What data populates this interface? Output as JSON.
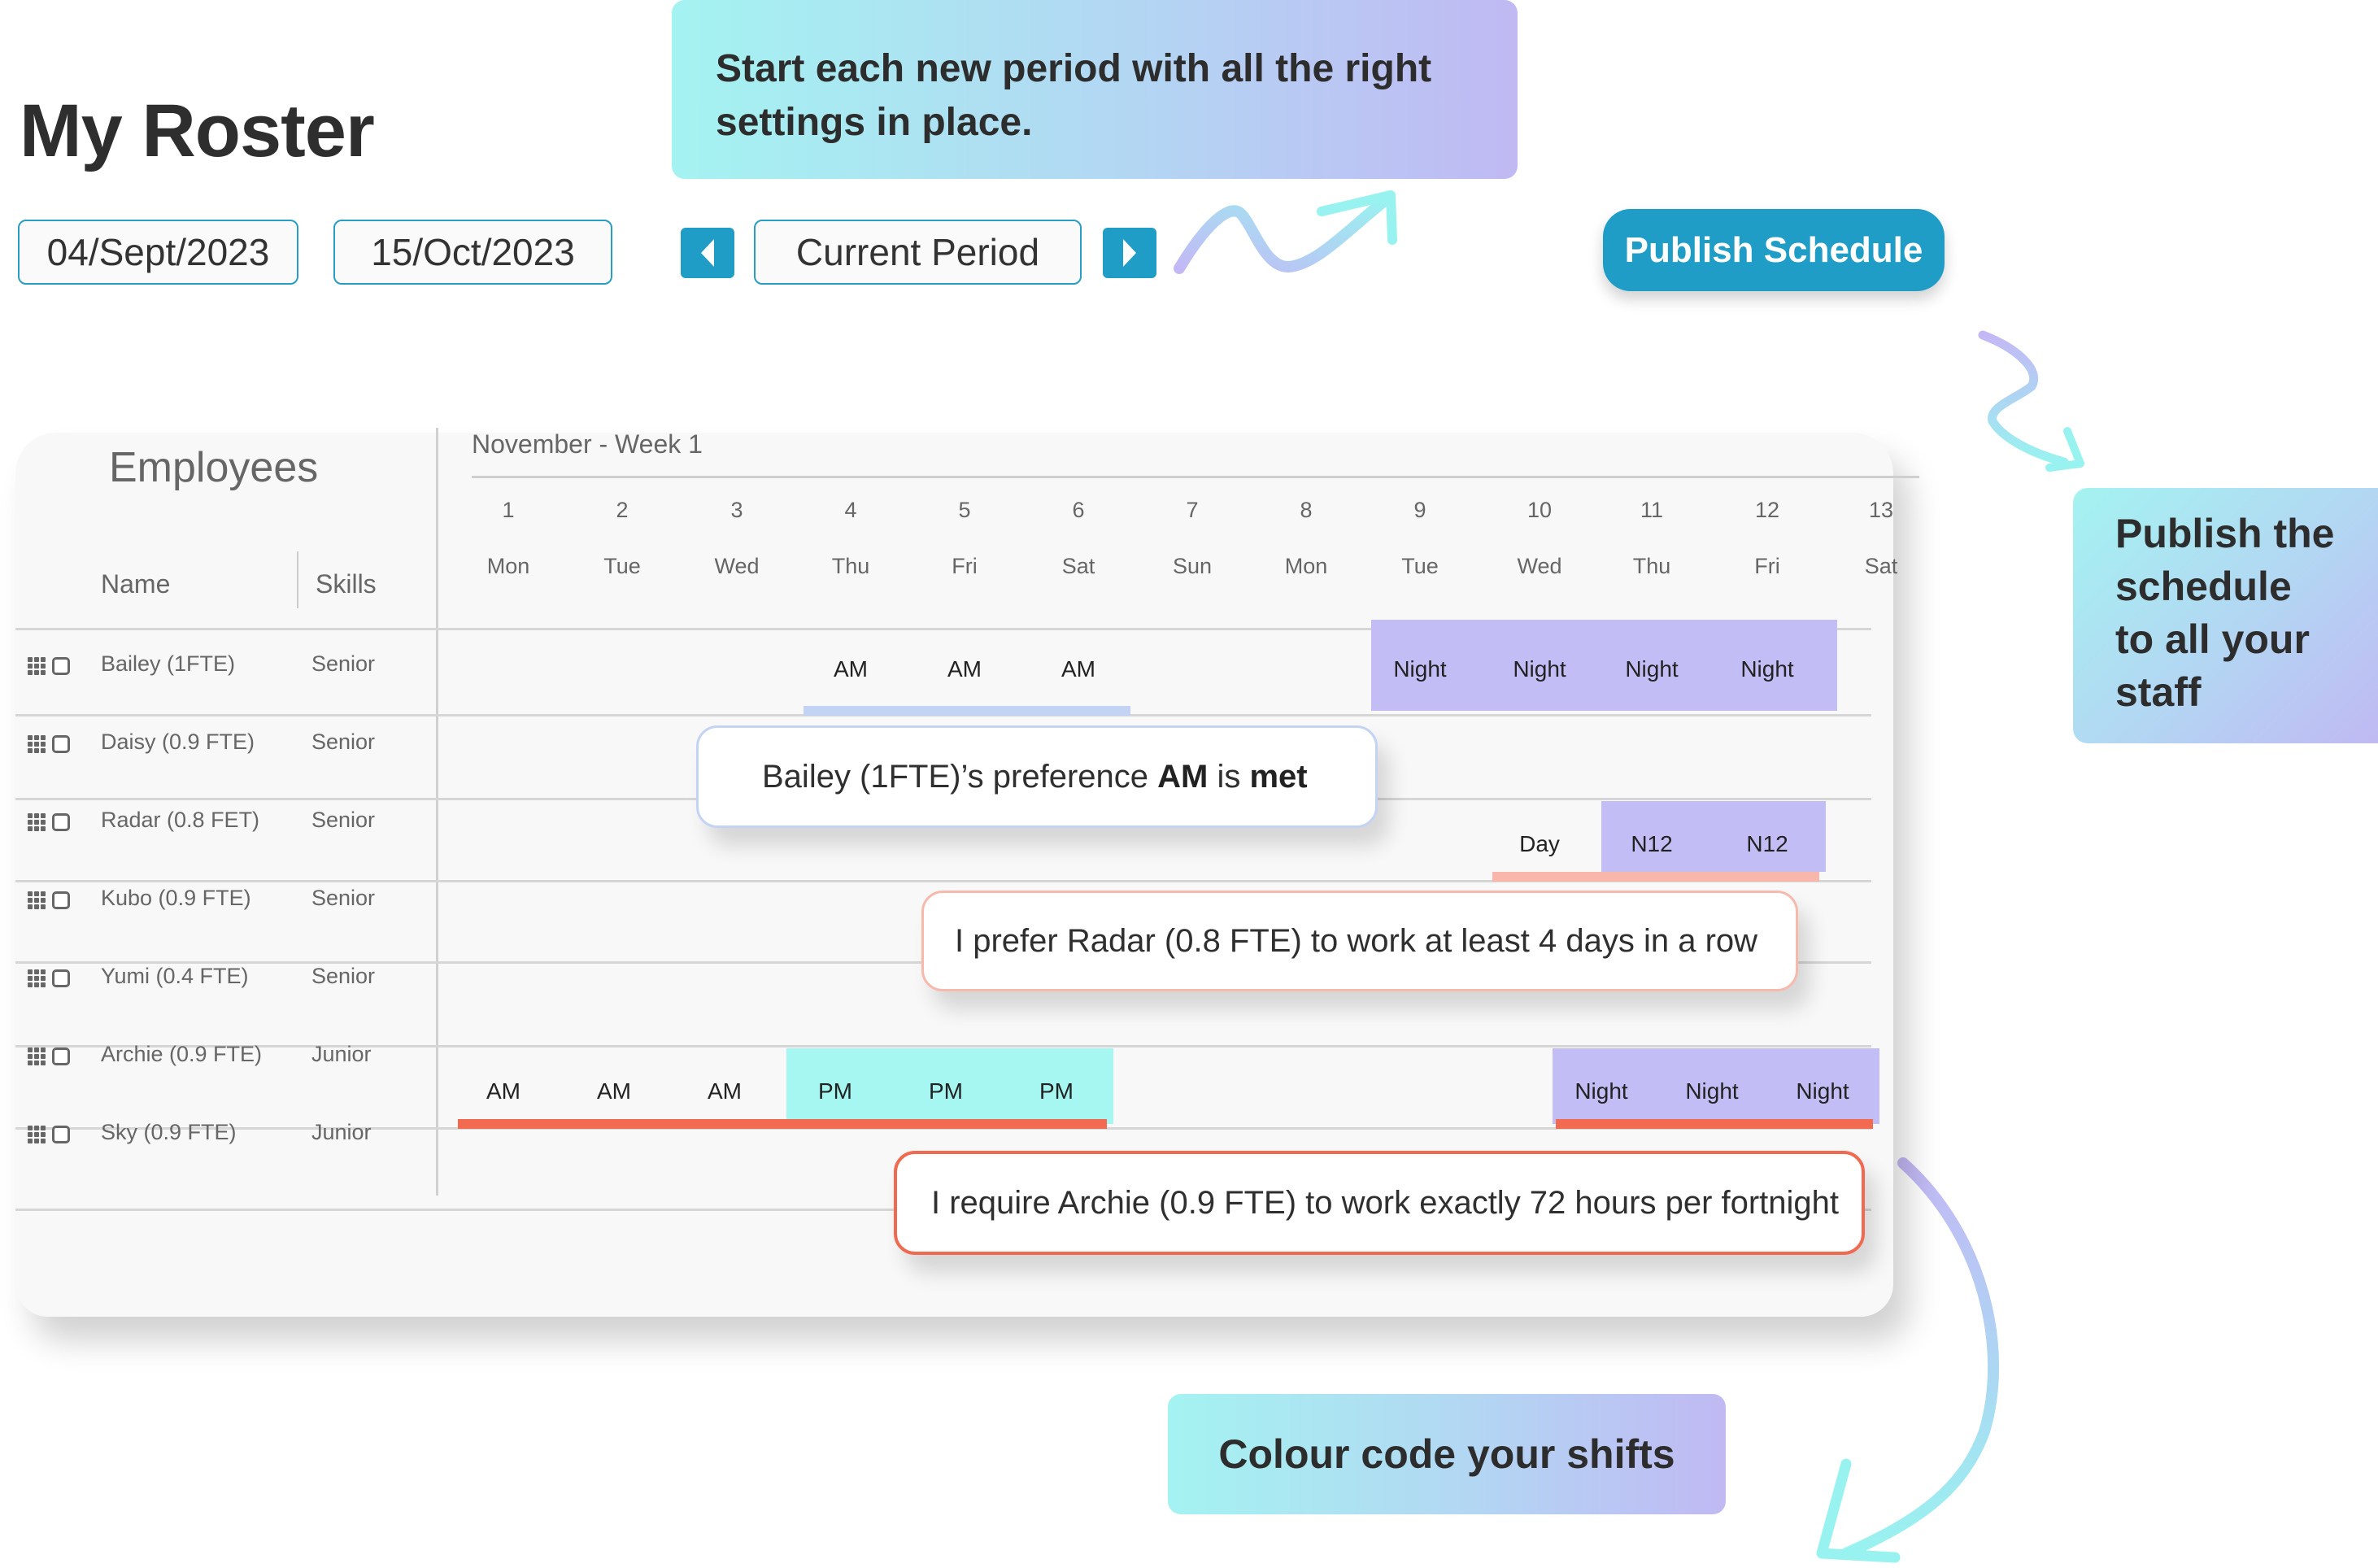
{
  "page": {
    "title": "My Roster",
    "start_date": "04/Sept/2023",
    "end_date": "15/Oct/2023",
    "period_label": "Current Period",
    "prev_icon": "caret-left-icon",
    "next_icon": "caret-right-icon",
    "publish_label": "Publish Schedule"
  },
  "callouts": {
    "period": "Start each new period with all the right settings in place.",
    "publish": "Publish the schedule to all your staff",
    "colour": "Colour code your shifts"
  },
  "colors": {
    "accent": "#1f9dc7",
    "am_underline": "#c3d3f4",
    "night": "#c2bdf5",
    "pm": "#a6f7f2",
    "soft_warning": "#f9b6aa",
    "hard_warning": "#f26a50"
  },
  "table": {
    "panel_title": "Employees",
    "name_header": "Name",
    "skills_header": "Skills",
    "week_label": "November - Week 1",
    "days": [
      {
        "num": "1",
        "name": "Mon"
      },
      {
        "num": "2",
        "name": "Tue"
      },
      {
        "num": "3",
        "name": "Wed"
      },
      {
        "num": "4",
        "name": "Thu"
      },
      {
        "num": "5",
        "name": "Fri"
      },
      {
        "num": "6",
        "name": "Sat"
      },
      {
        "num": "7",
        "name": "Sun"
      },
      {
        "num": "8",
        "name": "Mon"
      },
      {
        "num": "9",
        "name": "Tue"
      },
      {
        "num": "10",
        "name": "Wed"
      },
      {
        "num": "11",
        "name": "Thu"
      },
      {
        "num": "12",
        "name": "Fri"
      },
      {
        "num": "13",
        "name": "Sat"
      }
    ],
    "employees": [
      {
        "name": "Bailey (1FTE)",
        "skill": "Senior",
        "shifts": [
          {
            "day": 4,
            "label": "AM"
          },
          {
            "day": 5,
            "label": "AM"
          },
          {
            "day": 6,
            "label": "AM"
          },
          {
            "day": 9,
            "label": "Night",
            "fill": "night"
          },
          {
            "day": 10,
            "label": "Night",
            "fill": "night"
          },
          {
            "day": 11,
            "label": "Night",
            "fill": "night"
          },
          {
            "day": 12,
            "label": "Night",
            "fill": "night"
          }
        ],
        "underlines": [
          {
            "from": 4,
            "to": 6,
            "color": "am_underline"
          }
        ]
      },
      {
        "name": "Daisy (0.9 FTE)",
        "skill": "Senior",
        "shifts": [],
        "underlines": []
      },
      {
        "name": "Radar (0.8 FET)",
        "skill": "Senior",
        "shifts": [
          {
            "day": 10,
            "label": "Day"
          },
          {
            "day": 11,
            "label": "N12",
            "fill": "night"
          },
          {
            "day": 12,
            "label": "N12",
            "fill": "night"
          }
        ],
        "underlines": [
          {
            "from": 10,
            "to": 12,
            "color": "soft_warning"
          }
        ]
      },
      {
        "name": "Kubo (0.9 FTE)",
        "skill": "Senior",
        "shifts": [],
        "underlines": []
      },
      {
        "name": "Yumi (0.4 FTE)",
        "skill": "Senior",
        "shifts": [],
        "underlines": []
      },
      {
        "name": "Archie (0.9 FTE)",
        "skill": "Junior",
        "shifts": [
          {
            "day": 1,
            "label": "AM"
          },
          {
            "day": 2,
            "label": "AM"
          },
          {
            "day": 3,
            "label": "AM"
          },
          {
            "day": 4,
            "label": "PM",
            "fill": "pm"
          },
          {
            "day": 5,
            "label": "PM",
            "fill": "pm"
          },
          {
            "day": 6,
            "label": "PM",
            "fill": "pm"
          },
          {
            "day": 10,
            "label": "Night",
            "fill": "night"
          },
          {
            "day": 11,
            "label": "Night",
            "fill": "night"
          },
          {
            "day": 12,
            "label": "Night",
            "fill": "night"
          }
        ],
        "underlines": [
          {
            "from": 1,
            "to": 6,
            "color": "hard_warning"
          },
          {
            "from": 10,
            "to": 12,
            "color": "hard_warning"
          }
        ]
      },
      {
        "name": "Sky (0.9 FTE)",
        "skill": "Junior",
        "shifts": [],
        "underlines": []
      }
    ]
  },
  "tooltips": {
    "bailey": {
      "prefix": "Bailey (1FTE)’s preference ",
      "b1": "AM",
      "mid": " is ",
      "b2": "met"
    },
    "radar": "I prefer Radar (0.8 FTE) to work at least 4 days in a row",
    "archie": "I require Archie (0.9 FTE) to work exactly 72 hours per fortnight"
  }
}
